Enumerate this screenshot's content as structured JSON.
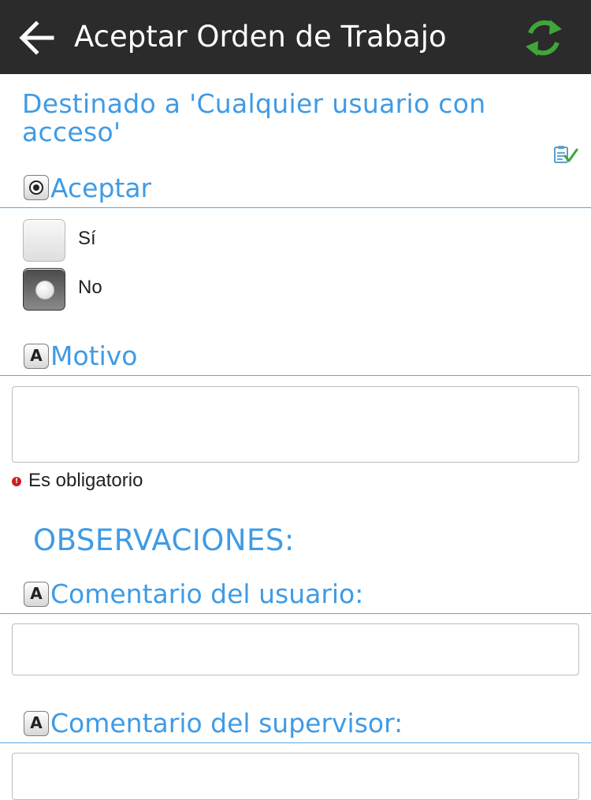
{
  "appbar": {
    "title": "Aceptar Orden de Trabajo",
    "back_icon": "arrow-left-icon",
    "sync_icon": "refresh-icon",
    "sync_color": "#3fa63a"
  },
  "destination": {
    "title": "Destinado a 'Cualquier usuario con acceso'",
    "status_icon": "clipboard-check-icon"
  },
  "accept_section": {
    "label": "Aceptar",
    "type_icon": "radio-type-icon",
    "options": [
      {
        "label": "Sí",
        "selected": false
      },
      {
        "label": "No",
        "selected": true
      }
    ]
  },
  "motivo_section": {
    "label": "Motivo",
    "type_icon": "text-type-icon",
    "type_icon_text": "A",
    "value": "",
    "required_text": "Es obligatorio",
    "required_icon": "error-icon",
    "required_icon_text": "!"
  },
  "observaciones": {
    "title": "OBSERVACIONES:"
  },
  "user_comment_section": {
    "label": "Comentario del usuario:",
    "type_icon_text": "A",
    "value": ""
  },
  "supervisor_comment_section": {
    "label": "Comentario del supervisor:",
    "type_icon_text": "A",
    "value": ""
  },
  "colors": {
    "appbar": "#2b2b2b",
    "accent": "#3f9be6",
    "error": "#cc1f1f"
  }
}
